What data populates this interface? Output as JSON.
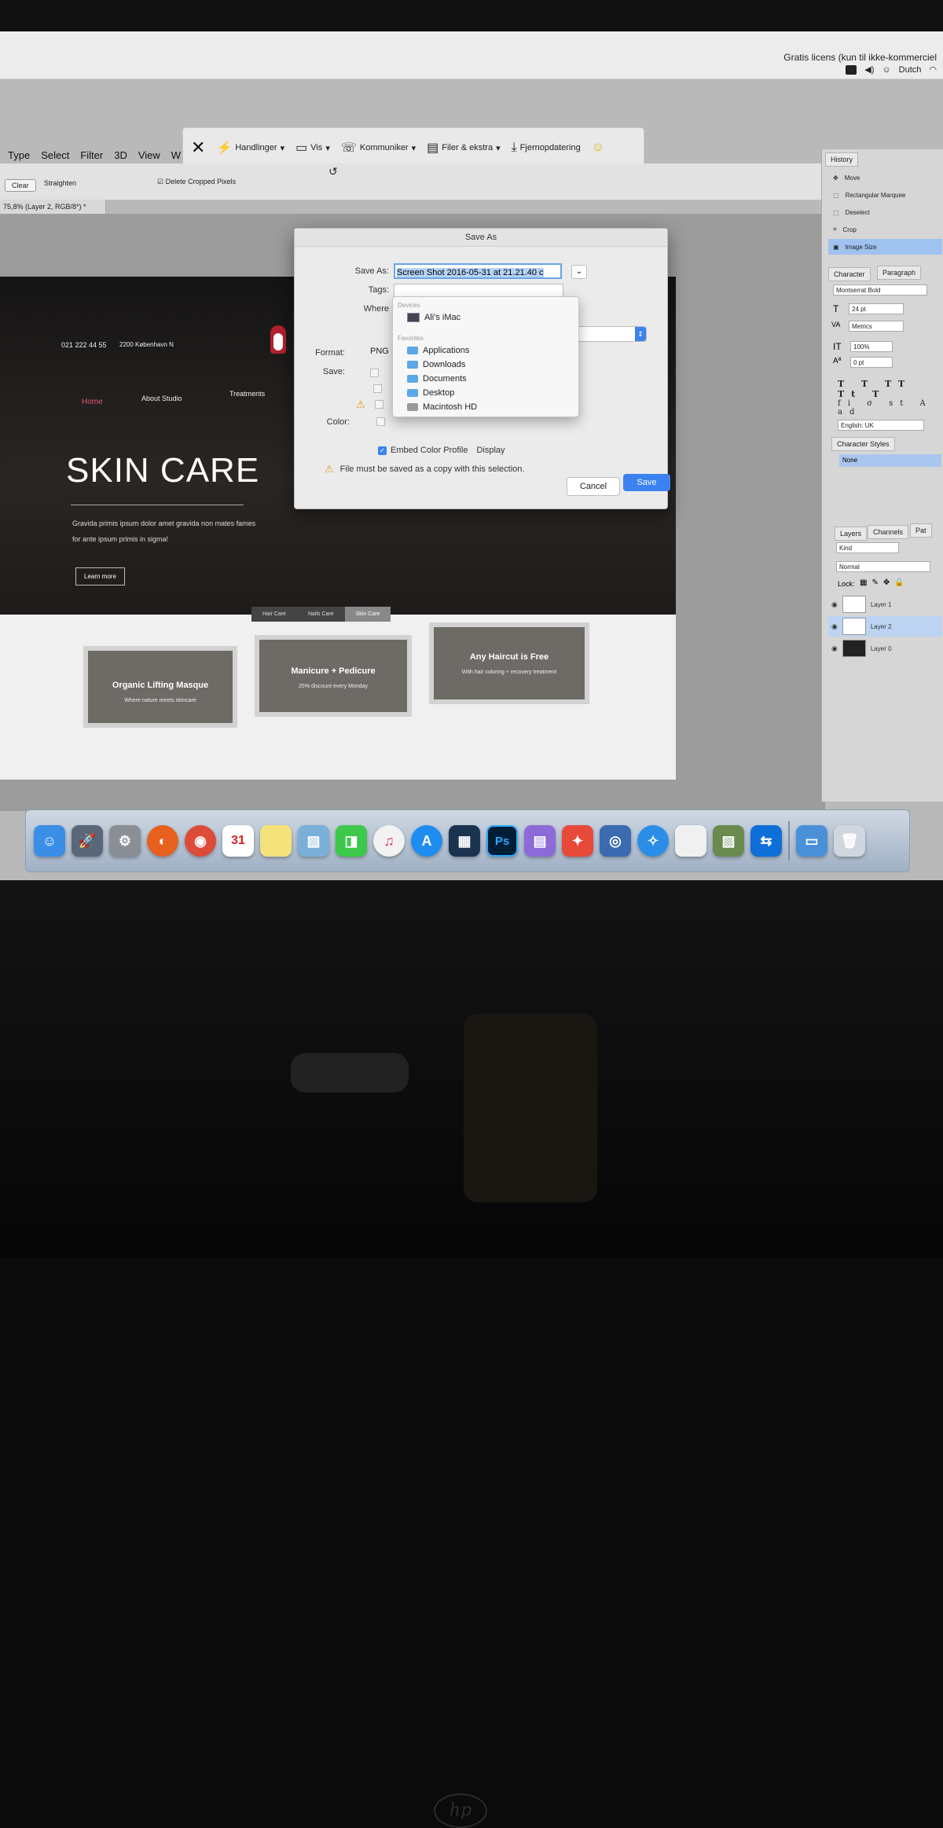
{
  "menubar": {
    "license_text": "Gratis licens (kun til ikke-kommerciel",
    "input_source": "Dutch"
  },
  "ps_menu": [
    "Type",
    "Select",
    "Filter",
    "3D",
    "View",
    "W"
  ],
  "translate_toolbar": {
    "items": [
      "Handlinger",
      "Vis",
      "Kommuniker",
      "Filer & ekstra",
      "Fjernopdatering"
    ]
  },
  "options_bar": {
    "clear_label": "Clear",
    "straighten_label": "Straighten",
    "delete_cropped": "Delete Cropped Pixels"
  },
  "document_tab": "75,8% (Layer 2, RGB/8*) *",
  "site": {
    "phone": "021 222 44 55",
    "location": "2200 København N",
    "nav": [
      "Home",
      "About Studio",
      "Treatments"
    ],
    "hero_title": "SKIN CARE",
    "hero_text": "Gravida primis ipsum dolor amet gravida non mates fames for ante ipsum primis in sigma!",
    "cta": "Learn more",
    "tabs": [
      "Hair Care",
      "Nails Care",
      "Skin Care"
    ],
    "cards": [
      {
        "title": "Organic Lifting Masque",
        "sub": "Where nature meets skincare"
      },
      {
        "title": "Manicure + Pedicure",
        "sub": "25% discount every Monday"
      },
      {
        "title": "Any Haircut is Free",
        "sub": "With hair coloring + recovery treatment"
      }
    ]
  },
  "dialog": {
    "title": "Save As",
    "save_as_label": "Save As:",
    "filename": "Screen Shot 2016-05-31 at 21.21.40 c",
    "tags_label": "Tags:",
    "where_label": "Where",
    "format_label": "Format:",
    "format_value": "PNG",
    "save_label": "Save:",
    "color_label": "Color:",
    "embed_profile": "Embed Color Profile",
    "embed_profile_value": "Display",
    "warning": "File must be saved as a copy with this selection.",
    "cancel": "Cancel",
    "save": "Save",
    "location_menu": {
      "devices_header": "Devices",
      "devices": [
        "Ali's iMac"
      ],
      "favorites_header": "Favorites",
      "favorites": [
        "Applications",
        "Downloads",
        "Documents",
        "Desktop",
        "Macintosh HD"
      ]
    }
  },
  "panels": {
    "history_tab": "History",
    "history": [
      "Move",
      "Rectangular Marquee",
      "Deselect",
      "Crop",
      "Image Size"
    ],
    "character_tabs": [
      "Character",
      "Paragraph"
    ],
    "font": "Montserrat Bold",
    "size": "24 pt",
    "kerning": "Metrics",
    "vscale": "100%",
    "baseline": "0 pt",
    "language": "English: UK",
    "char_styles_tab": "Character Styles",
    "char_styles_value": "None",
    "layer_tabs": [
      "Layers",
      "Channels",
      "Pat"
    ],
    "layer_kind": "Kind",
    "blend_mode": "Normal",
    "lock_label": "Lock:",
    "layers": [
      "Layer 1",
      "Layer 2",
      "Layer 0"
    ]
  },
  "dock": {
    "calendar_day": "31",
    "ps_label": "Ps"
  }
}
